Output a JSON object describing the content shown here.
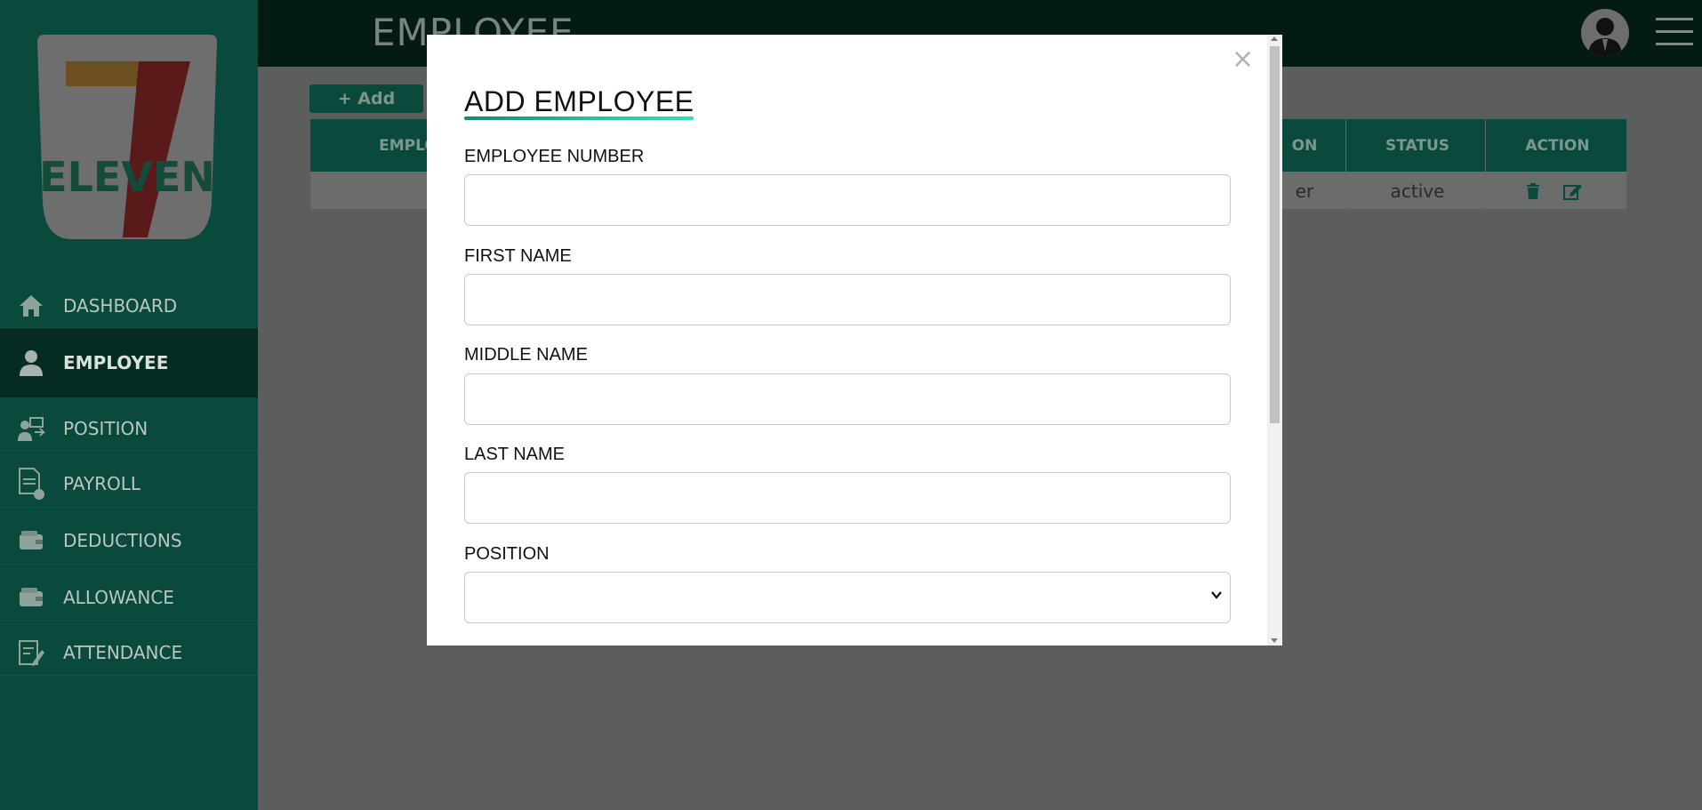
{
  "app": {
    "page_title": "EMPLOYEE",
    "logo_text": "ELEVEN",
    "logo_numeral": "7"
  },
  "sidebar": {
    "items": [
      {
        "label": "DASHBOARD",
        "icon": "home-icon",
        "active": false
      },
      {
        "label": "EMPLOYEE",
        "icon": "user-icon",
        "active": true
      },
      {
        "label": "POSITION",
        "icon": "position-icon",
        "active": false
      },
      {
        "label": "PAYROLL",
        "icon": "payroll-icon",
        "active": false
      },
      {
        "label": "DEDUCTIONS",
        "icon": "wallet-icon",
        "active": false
      },
      {
        "label": "ALLOWANCE",
        "icon": "wallet-icon",
        "active": false
      },
      {
        "label": "ATTENDANCE",
        "icon": "attendance-icon",
        "active": false
      }
    ]
  },
  "toolbar": {
    "add_label": "+ Add"
  },
  "table": {
    "columns": [
      "EMPLO",
      "ON",
      "STATUS",
      "ACTION"
    ],
    "rows": [
      {
        "position_fragment": "er",
        "status": "active"
      }
    ]
  },
  "modal": {
    "title": "ADD EMPLOYEE",
    "close_glyph": "×",
    "fields": {
      "employee_number": {
        "label": "EMPLOYEE NUMBER",
        "value": ""
      },
      "first_name": {
        "label": "FIRST NAME",
        "value": ""
      },
      "middle_name": {
        "label": "MIDDLE NAME",
        "value": ""
      },
      "last_name": {
        "label": "LAST NAME",
        "value": ""
      },
      "position": {
        "label": "POSITION",
        "value": ""
      }
    }
  },
  "colors": {
    "sidebar_bg": "#0a4a3d",
    "active_item_bg": "#062b23",
    "topbar_bg": "#041a15",
    "overlay": "#5b5e5c",
    "accent": "#1fc9a0"
  }
}
